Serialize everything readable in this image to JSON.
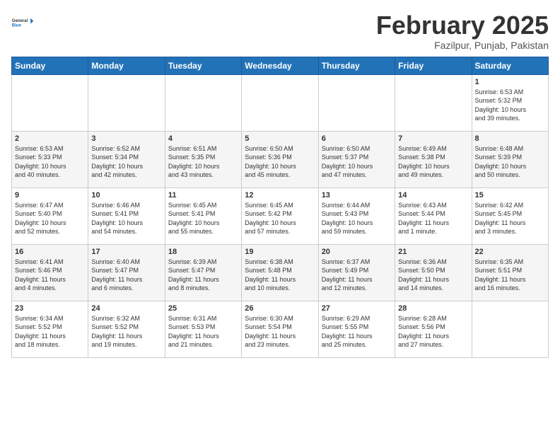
{
  "logo": {
    "line1": "General",
    "line2": "Blue"
  },
  "title": "February 2025",
  "subtitle": "Fazilpur, Punjab, Pakistan",
  "days_of_week": [
    "Sunday",
    "Monday",
    "Tuesday",
    "Wednesday",
    "Thursday",
    "Friday",
    "Saturday"
  ],
  "weeks": [
    [
      {
        "day": "",
        "info": ""
      },
      {
        "day": "",
        "info": ""
      },
      {
        "day": "",
        "info": ""
      },
      {
        "day": "",
        "info": ""
      },
      {
        "day": "",
        "info": ""
      },
      {
        "day": "",
        "info": ""
      },
      {
        "day": "1",
        "info": "Sunrise: 6:53 AM\nSunset: 5:32 PM\nDaylight: 10 hours\nand 39 minutes."
      }
    ],
    [
      {
        "day": "2",
        "info": "Sunrise: 6:53 AM\nSunset: 5:33 PM\nDaylight: 10 hours\nand 40 minutes."
      },
      {
        "day": "3",
        "info": "Sunrise: 6:52 AM\nSunset: 5:34 PM\nDaylight: 10 hours\nand 42 minutes."
      },
      {
        "day": "4",
        "info": "Sunrise: 6:51 AM\nSunset: 5:35 PM\nDaylight: 10 hours\nand 43 minutes."
      },
      {
        "day": "5",
        "info": "Sunrise: 6:50 AM\nSunset: 5:36 PM\nDaylight: 10 hours\nand 45 minutes."
      },
      {
        "day": "6",
        "info": "Sunrise: 6:50 AM\nSunset: 5:37 PM\nDaylight: 10 hours\nand 47 minutes."
      },
      {
        "day": "7",
        "info": "Sunrise: 6:49 AM\nSunset: 5:38 PM\nDaylight: 10 hours\nand 49 minutes."
      },
      {
        "day": "8",
        "info": "Sunrise: 6:48 AM\nSunset: 5:39 PM\nDaylight: 10 hours\nand 50 minutes."
      }
    ],
    [
      {
        "day": "9",
        "info": "Sunrise: 6:47 AM\nSunset: 5:40 PM\nDaylight: 10 hours\nand 52 minutes."
      },
      {
        "day": "10",
        "info": "Sunrise: 6:46 AM\nSunset: 5:41 PM\nDaylight: 10 hours\nand 54 minutes."
      },
      {
        "day": "11",
        "info": "Sunrise: 6:45 AM\nSunset: 5:41 PM\nDaylight: 10 hours\nand 55 minutes."
      },
      {
        "day": "12",
        "info": "Sunrise: 6:45 AM\nSunset: 5:42 PM\nDaylight: 10 hours\nand 57 minutes."
      },
      {
        "day": "13",
        "info": "Sunrise: 6:44 AM\nSunset: 5:43 PM\nDaylight: 10 hours\nand 59 minutes."
      },
      {
        "day": "14",
        "info": "Sunrise: 6:43 AM\nSunset: 5:44 PM\nDaylight: 11 hours\nand 1 minute."
      },
      {
        "day": "15",
        "info": "Sunrise: 6:42 AM\nSunset: 5:45 PM\nDaylight: 11 hours\nand 3 minutes."
      }
    ],
    [
      {
        "day": "16",
        "info": "Sunrise: 6:41 AM\nSunset: 5:46 PM\nDaylight: 11 hours\nand 4 minutes."
      },
      {
        "day": "17",
        "info": "Sunrise: 6:40 AM\nSunset: 5:47 PM\nDaylight: 11 hours\nand 6 minutes."
      },
      {
        "day": "18",
        "info": "Sunrise: 6:39 AM\nSunset: 5:47 PM\nDaylight: 11 hours\nand 8 minutes."
      },
      {
        "day": "19",
        "info": "Sunrise: 6:38 AM\nSunset: 5:48 PM\nDaylight: 11 hours\nand 10 minutes."
      },
      {
        "day": "20",
        "info": "Sunrise: 6:37 AM\nSunset: 5:49 PM\nDaylight: 11 hours\nand 12 minutes."
      },
      {
        "day": "21",
        "info": "Sunrise: 6:36 AM\nSunset: 5:50 PM\nDaylight: 11 hours\nand 14 minutes."
      },
      {
        "day": "22",
        "info": "Sunrise: 6:35 AM\nSunset: 5:51 PM\nDaylight: 11 hours\nand 16 minutes."
      }
    ],
    [
      {
        "day": "23",
        "info": "Sunrise: 6:34 AM\nSunset: 5:52 PM\nDaylight: 11 hours\nand 18 minutes."
      },
      {
        "day": "24",
        "info": "Sunrise: 6:32 AM\nSunset: 5:52 PM\nDaylight: 11 hours\nand 19 minutes."
      },
      {
        "day": "25",
        "info": "Sunrise: 6:31 AM\nSunset: 5:53 PM\nDaylight: 11 hours\nand 21 minutes."
      },
      {
        "day": "26",
        "info": "Sunrise: 6:30 AM\nSunset: 5:54 PM\nDaylight: 11 hours\nand 23 minutes."
      },
      {
        "day": "27",
        "info": "Sunrise: 6:29 AM\nSunset: 5:55 PM\nDaylight: 11 hours\nand 25 minutes."
      },
      {
        "day": "28",
        "info": "Sunrise: 6:28 AM\nSunset: 5:56 PM\nDaylight: 11 hours\nand 27 minutes."
      },
      {
        "day": "",
        "info": ""
      }
    ]
  ]
}
